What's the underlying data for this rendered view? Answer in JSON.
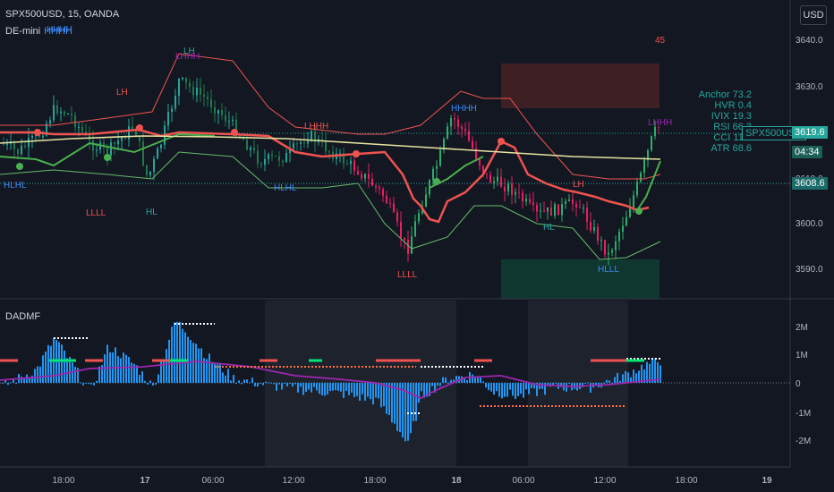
{
  "header": {
    "symbol_line": "SPX500USD, 15, OANDA",
    "indicator_name": "DE-mini",
    "indicator_tag": "HHHH",
    "currency_button": "USD"
  },
  "oscillator": {
    "title": "DADMF"
  },
  "annotation_top": "45",
  "stats_panel": [
    "Anchor 73.2",
    "HVR 0.4",
    "IVIX 19.3",
    "RSI 66.3",
    "CCI 110.",
    "ATR 68.6"
  ],
  "price_labels": {
    "last_symbol": "SPX500USD",
    "last_price": "3619.6",
    "countdown": "04:34",
    "level_price": "3608.6"
  },
  "chart_data": {
    "type": "line",
    "price_axis": {
      "ticks": [
        "3640.0",
        "3630.0",
        "3620.0",
        "3610.0",
        "3600.0",
        "3590.0"
      ],
      "ylim": [
        3585,
        3645
      ]
    },
    "osc_axis": {
      "ticks": [
        "2M",
        "1M",
        "0",
        "-1M",
        "-2M"
      ]
    },
    "time_axis": [
      "18:00",
      "17",
      "06:00",
      "12:00",
      "18:00",
      "18",
      "06:00",
      "12:00",
      "18:00",
      "19"
    ],
    "swing_labels": [
      "HHHH",
      "LHHH",
      "LH",
      "LHHH",
      "HHHH",
      "LH",
      "LHHH",
      "HLHL",
      "LLLL",
      "HL",
      "HLHL",
      "LLLL",
      "HL",
      "LH",
      "HLLL"
    ],
    "colors": {
      "up": "#26a69a",
      "down": "#ef5350",
      "osc_bar": "#2196f3",
      "osc_line": "#9c27b0",
      "ma": "#e6e3a0"
    }
  }
}
